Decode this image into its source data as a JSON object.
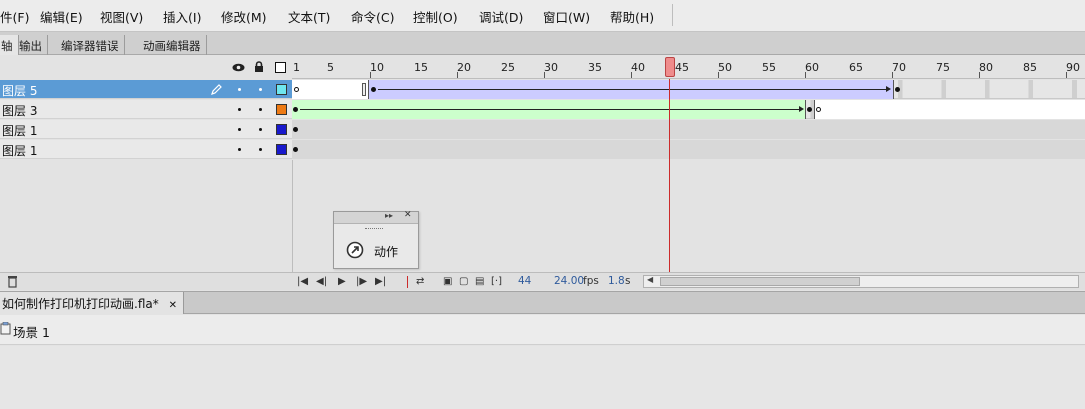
{
  "menu": [
    {
      "id": "file",
      "label": "件(F)"
    },
    {
      "id": "edit",
      "label": "编辑(E)"
    },
    {
      "id": "view",
      "label": "视图(V)"
    },
    {
      "id": "insert",
      "label": "插入(I)"
    },
    {
      "id": "modify",
      "label": "修改(M)"
    },
    {
      "id": "text",
      "label": "文本(T)"
    },
    {
      "id": "commands",
      "label": "命令(C)"
    },
    {
      "id": "control",
      "label": "控制(O)"
    },
    {
      "id": "debug",
      "label": "调试(D)"
    },
    {
      "id": "window",
      "label": "窗口(W)"
    },
    {
      "id": "help",
      "label": "帮助(H)"
    }
  ],
  "panel_tabs": [
    "轴",
    "输出",
    "编译器错误",
    "动画编辑器"
  ],
  "ruler_ticks": [
    "1",
    "5",
    "10",
    "15",
    "20",
    "25",
    "30",
    "35",
    "40",
    "45",
    "50",
    "55",
    "60",
    "65",
    "70",
    "75",
    "80",
    "85",
    "90"
  ],
  "layers": [
    {
      "name": "图层 5",
      "selected": true,
      "color": "#6fe6ee"
    },
    {
      "name": "图层 3",
      "selected": false,
      "color": "#ee7a14"
    },
    {
      "name": "图层 1",
      "selected": false,
      "color": "#1a1acc"
    },
    {
      "name": "图层 1",
      "selected": false,
      "color": "#1a1acc"
    }
  ],
  "action_panel": {
    "label": "动作"
  },
  "status": {
    "current_frame": "44",
    "frame_rate": "24.00",
    "frame_rate_unit": "fps",
    "elapsed": "1.8",
    "elapsed_unit": "s"
  },
  "document": {
    "tab_title": "如何制作打印机打印动画.fla*",
    "close": "✕"
  },
  "breadcrumb": {
    "scene": "场景 1"
  },
  "colors": {
    "selected_layer": "#5b9bd5",
    "motion_tween": "#ccccff",
    "shape_tween": "#ccffcc",
    "playhead": "#cc2b2b"
  }
}
